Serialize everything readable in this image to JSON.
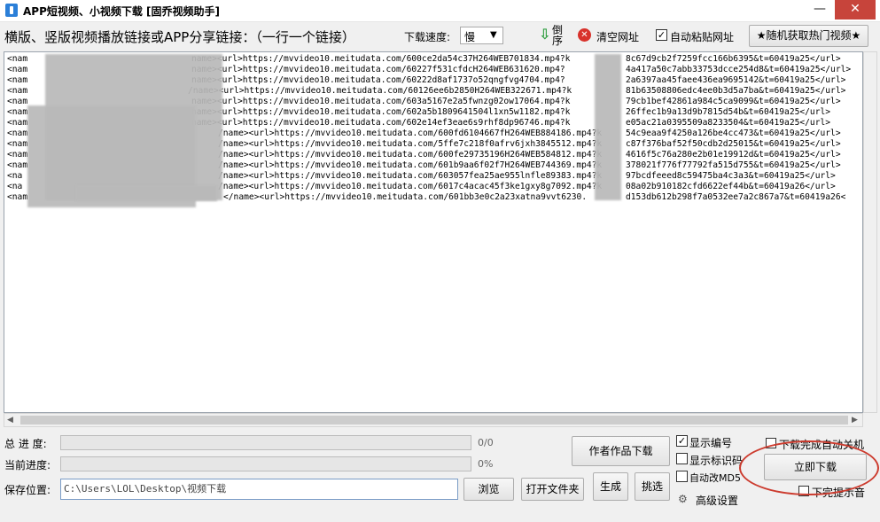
{
  "window": {
    "title": "APP短视频、小视频下载 [固乔视频助手]",
    "minimize": "—",
    "maximize": "☐",
    "close": "✕"
  },
  "toolbar": {
    "prompt": "横版、竖版视频播放链接或APP分享链接：（一行一个链接）",
    "speed_label": "下载速度:",
    "speed_value": "慢",
    "reverse_label": "倒序",
    "clear_label": "清空网址",
    "auto_paste_label": "自动粘贴网址",
    "auto_paste_checked": true,
    "random_hot_label": "★随机获取热门视频★"
  },
  "links": [
    {
      "prefix": "<nam",
      "mid": "name><url>https://mvvideo10.meitudata.com/600ce2da54c37H264WEB701834.mp4?k",
      "tail": "8c67d9cb2f7259fcc166b6395&t=60419a25</url>"
    },
    {
      "prefix": "<nam",
      "mid": "name><url>https://mvvideo10.meitudata.com/60227f531cfdcH264WEB631620.mp4?",
      "tail": "4a417a50c7abb33753dcce254d8&t=60419a25</url>"
    },
    {
      "prefix": "<nam",
      "mid": "name><url>https://mvvideo10.meitudata.com/60222d8af1737o52qngfvg4704.mp4?",
      "tail": "2a6397aa45faee436ea9695142&t=60419a25</url>"
    },
    {
      "prefix": "<nam",
      "mid": "/name><url>https://mvvideo10.meitudata.com/60126ee6b2850H264WEB322671.mp4?k",
      "tail": "81b63508806edc4ee0b3d5a7ba&t=60419a25</url>"
    },
    {
      "prefix": "<nam",
      "mid": "name><url>https://mvvideo10.meitudata.com/603a5167e2a5fwnzg02ow17064.mp4?k",
      "tail": "79cb1bef42861a984c5ca9099&t=60419a25</url>"
    },
    {
      "prefix": "<nam",
      "mid": "name><url>https://mvvideo10.meitudata.com/602a5b1809641504l1xn5w1182.mp4?k",
      "tail": "26ffec1b9a13d9b7815d54b&t=60419a25</url>"
    },
    {
      "prefix": "<nam",
      "mid": "name><url>https://mvvideo10.meitudata.com/602e14ef3eae6s9rhf8dp96746.mp4?k",
      "tail": "e05ac21a0395509a8233504&t=60419a25</url>"
    },
    {
      "prefix": "<nam",
      "mid": "/name><url>https://mvvideo10.meitudata.com/600fd6104667fH264WEB884186.mp4?k",
      "tail": "54c9eaa9f4250a126be4cc473&t=60419a25</url>"
    },
    {
      "prefix": "<nam",
      "mid": "/name><url>https://mvvideo10.meitudata.com/5ffe7c218f0afrv6jxh3845512.mp4?k",
      "tail": "c87f376baf52f50cdb2d25015&t=60419a25</url>"
    },
    {
      "prefix": "<nam",
      "mid": "/name><url>https://mvvideo10.meitudata.com/600fe29735196H264WEB584812.mp4?k",
      "tail": "4616f5c76a280e2b01e19912d&t=60419a25</url>"
    },
    {
      "prefix": "<nam",
      "mid": "/name><url>https://mvvideo10.meitudata.com/601b9aa6f02f7H264WEB744369.mp4?k",
      "tail": "378021f776f77792fa515d755&t=60419a25</url>"
    },
    {
      "prefix": "<na",
      "mid": "/name><url>https://mvvideo10.meitudata.com/603057fea25ae955lnfle89383.mp4?k",
      "tail": "97bcdfeeed8c59475ba4c3a3&t=60419a25</url>"
    },
    {
      "prefix": "<na",
      "mid": "/name><url>https://mvvideo10.meitudata.com/6017c4acac45f3ke1gxy8g7092.mp4?k",
      "tail": "08a02b910182cfd6622ef44b&t=60419a26</url>"
    },
    {
      "prefix": "<nam",
      "mid": "</name><url>https://mvvideo10.meitudata.com/601bb3e0c2a23xatna9vvt6230.",
      "tail": "d153db612b298f7a0532ee7a2c867a7&t=60419a26<"
    }
  ],
  "progress": {
    "total_label": "总 进 度:",
    "total_text": "0/0",
    "total_value": 0,
    "current_label": "当前进度:",
    "current_text": "0%",
    "current_value": 0
  },
  "save": {
    "label": "保存位置:",
    "path": "C:\\Users\\LOL\\Desktop\\视频下载",
    "browse": "浏览",
    "open_folder": "打开文件夹"
  },
  "actions": {
    "author_download": "作者作品下载",
    "generate": "生成",
    "pick": "挑选",
    "download_now": "立即下载",
    "advanced": "高级设置"
  },
  "options": [
    {
      "label": "显示编号",
      "checked": true
    },
    {
      "label": "显示标识码",
      "checked": false
    },
    {
      "label": "自动改MD5",
      "checked": false
    },
    {
      "label": "下载完成自动关机",
      "checked": false
    },
    {
      "label": "下完提示音",
      "checked": false
    }
  ],
  "colors": {
    "accent_red": "#cc3b2e",
    "clear_icon": "#d8322b",
    "reverse_arrow": "#2e9e3f"
  }
}
